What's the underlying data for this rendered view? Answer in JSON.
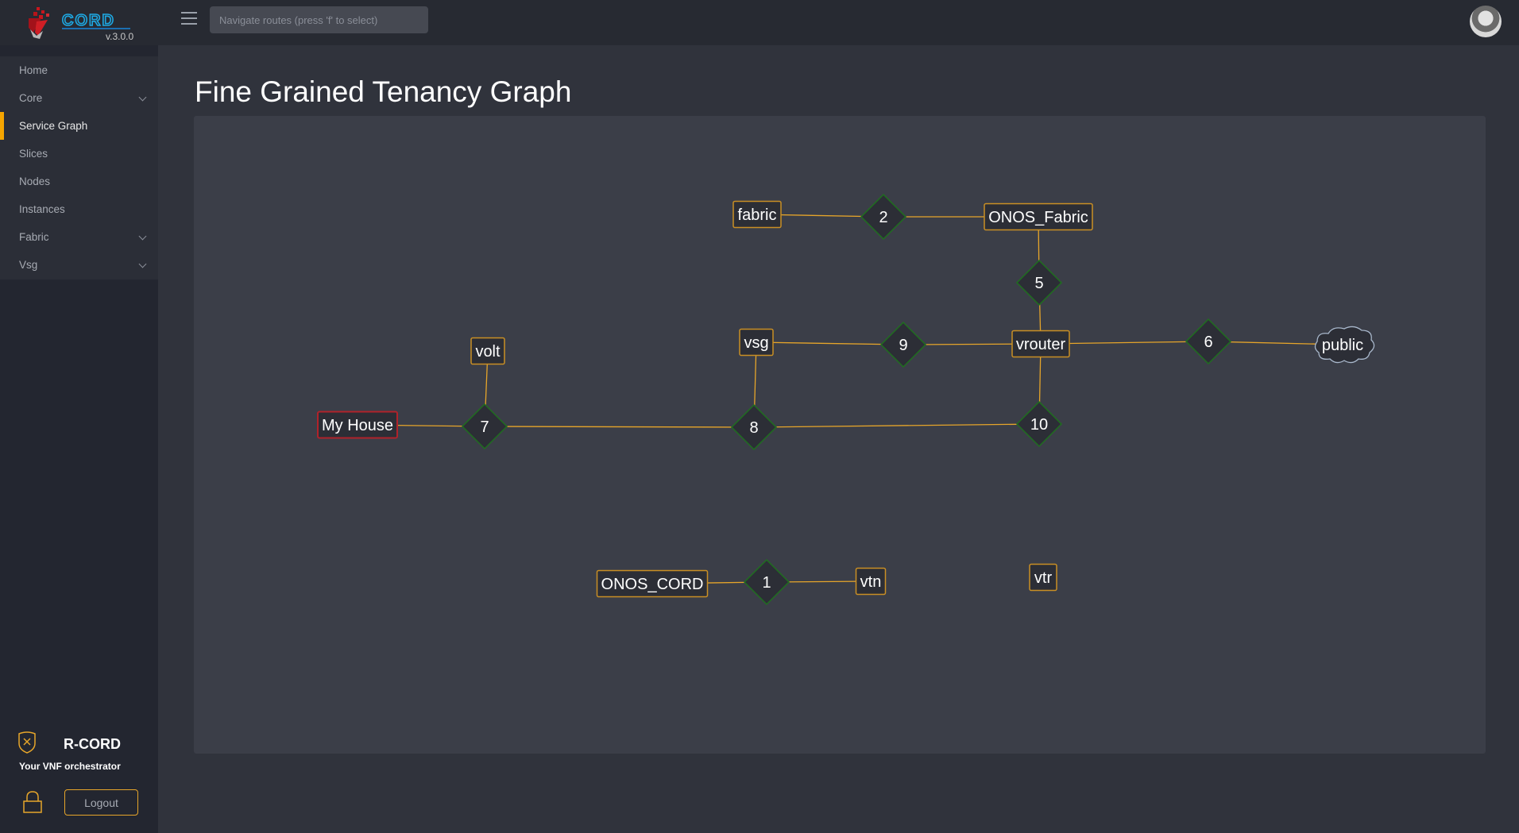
{
  "app": {
    "logo_text": "CORD",
    "version": "v.3.0.0"
  },
  "header": {
    "search": {
      "placeholder": "Navigate routes (press 'f' to select)",
      "value": ""
    },
    "menu_icon": "hamburger-icon",
    "avatar_icon": "user-avatar"
  },
  "sidebar": {
    "items": [
      {
        "label": "Home",
        "has_children": false,
        "active": false
      },
      {
        "label": "Core",
        "has_children": true,
        "active": false
      },
      {
        "label": "Service Graph",
        "has_children": false,
        "active": true
      },
      {
        "label": "Slices",
        "has_children": false,
        "active": false
      },
      {
        "label": "Nodes",
        "has_children": false,
        "active": false
      },
      {
        "label": "Instances",
        "has_children": false,
        "active": false
      },
      {
        "label": "Fabric",
        "has_children": true,
        "active": false
      },
      {
        "label": "Vsg",
        "has_children": true,
        "active": false
      }
    ],
    "brand": {
      "name": "R-CORD",
      "tagline": "Your VNF orchestrator"
    },
    "logout_label": "Logout"
  },
  "main": {
    "title": "Fine Grained Tenancy Graph"
  },
  "colors": {
    "accent": "#f5a500",
    "edge": "#e6a52a",
    "node_border": "#c98f24",
    "tenancy_border": "#1f6e1f",
    "subscriber_border": "#b0222a",
    "cloud_border": "#a9b8cc"
  },
  "graph": {
    "services": [
      {
        "id": "fabric",
        "label": "fabric",
        "kind": "service"
      },
      {
        "id": "onos_fabric",
        "label": "ONOS_Fabric",
        "kind": "service"
      },
      {
        "id": "vsg",
        "label": "vsg",
        "kind": "service"
      },
      {
        "id": "vrouter",
        "label": "vrouter",
        "kind": "service"
      },
      {
        "id": "volt",
        "label": "volt",
        "kind": "service"
      },
      {
        "id": "my_house",
        "label": "My House",
        "kind": "subscriber"
      },
      {
        "id": "public",
        "label": "public",
        "kind": "network"
      },
      {
        "id": "onos_cord",
        "label": "ONOS_CORD",
        "kind": "service"
      },
      {
        "id": "vtn",
        "label": "vtn",
        "kind": "service"
      },
      {
        "id": "vtr",
        "label": "vtr",
        "kind": "service"
      }
    ],
    "tenancies": [
      {
        "id": "t1",
        "label": "1"
      },
      {
        "id": "t2",
        "label": "2"
      },
      {
        "id": "t5",
        "label": "5"
      },
      {
        "id": "t6",
        "label": "6"
      },
      {
        "id": "t7",
        "label": "7"
      },
      {
        "id": "t8",
        "label": "8"
      },
      {
        "id": "t9",
        "label": "9"
      },
      {
        "id": "t10",
        "label": "10"
      }
    ],
    "links": [
      [
        "fabric",
        "t2"
      ],
      [
        "t2",
        "onos_fabric"
      ],
      [
        "onos_fabric",
        "t5"
      ],
      [
        "t5",
        "vrouter"
      ],
      [
        "vsg",
        "t9"
      ],
      [
        "t9",
        "vrouter"
      ],
      [
        "vrouter",
        "t6"
      ],
      [
        "t6",
        "public"
      ],
      [
        "vrouter",
        "t10"
      ],
      [
        "my_house",
        "t7"
      ],
      [
        "volt",
        "t7"
      ],
      [
        "t7",
        "t8"
      ],
      [
        "vsg",
        "t8"
      ],
      [
        "t8",
        "t10"
      ],
      [
        "onos_cord",
        "t1"
      ],
      [
        "t1",
        "vtn"
      ]
    ]
  }
}
